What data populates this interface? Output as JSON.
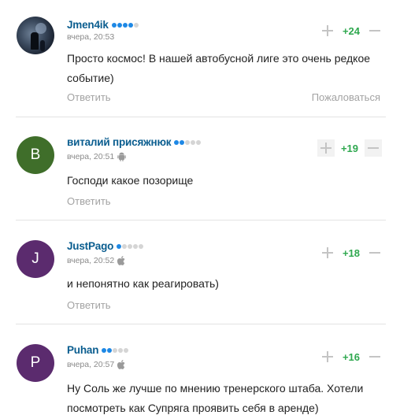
{
  "comments": [
    {
      "username": "Jmen4ik",
      "rating_dots_on": 4,
      "rating_dots_total": 5,
      "timestamp": "вчера, 20:53",
      "platform": "",
      "avatar": {
        "type": "photo",
        "letter": "",
        "color": ""
      },
      "text": "Просто космос! В нашей автобусной лиге это очень редкое событие)",
      "score": "+24",
      "reply_label": "Ответить",
      "report_label": "Пожаловаться"
    },
    {
      "username": "виталий присяжнюк",
      "rating_dots_on": 2,
      "rating_dots_total": 5,
      "timestamp": "вчера, 20:51",
      "platform": "android-icon",
      "avatar": {
        "type": "letter",
        "letter": "В",
        "color": "#3f6e2a"
      },
      "text": "Господи какое позорище",
      "score": "+19",
      "reply_label": "Ответить",
      "report_label": ""
    },
    {
      "username": "JustPago",
      "rating_dots_on": 1,
      "rating_dots_total": 5,
      "timestamp": "вчера, 20:52",
      "platform": "apple-icon",
      "avatar": {
        "type": "letter",
        "letter": "J",
        "color": "#5b2b6e"
      },
      "text": "и непонятно как реагировать)",
      "score": "+18",
      "reply_label": "Ответить",
      "report_label": ""
    },
    {
      "username": "Puhan",
      "rating_dots_on": 2,
      "rating_dots_total": 5,
      "timestamp": "вчера, 20:57",
      "platform": "apple-icon",
      "avatar": {
        "type": "letter",
        "letter": "P",
        "color": "#5b2b6e"
      },
      "text": "Ну Соль же лучше по мнению тренерского штаба. Хотели посмотреть как Супряга проявить себя в аренде)",
      "score": "+16",
      "reply_label": "",
      "report_label": ""
    }
  ],
  "colors": {
    "username": "#0a5d8f",
    "score_positive": "#2fa84f",
    "muted_text": "#a3a3a3",
    "rating_dot_on": "#1e88e5",
    "rating_dot_off": "#d5d5d5"
  }
}
